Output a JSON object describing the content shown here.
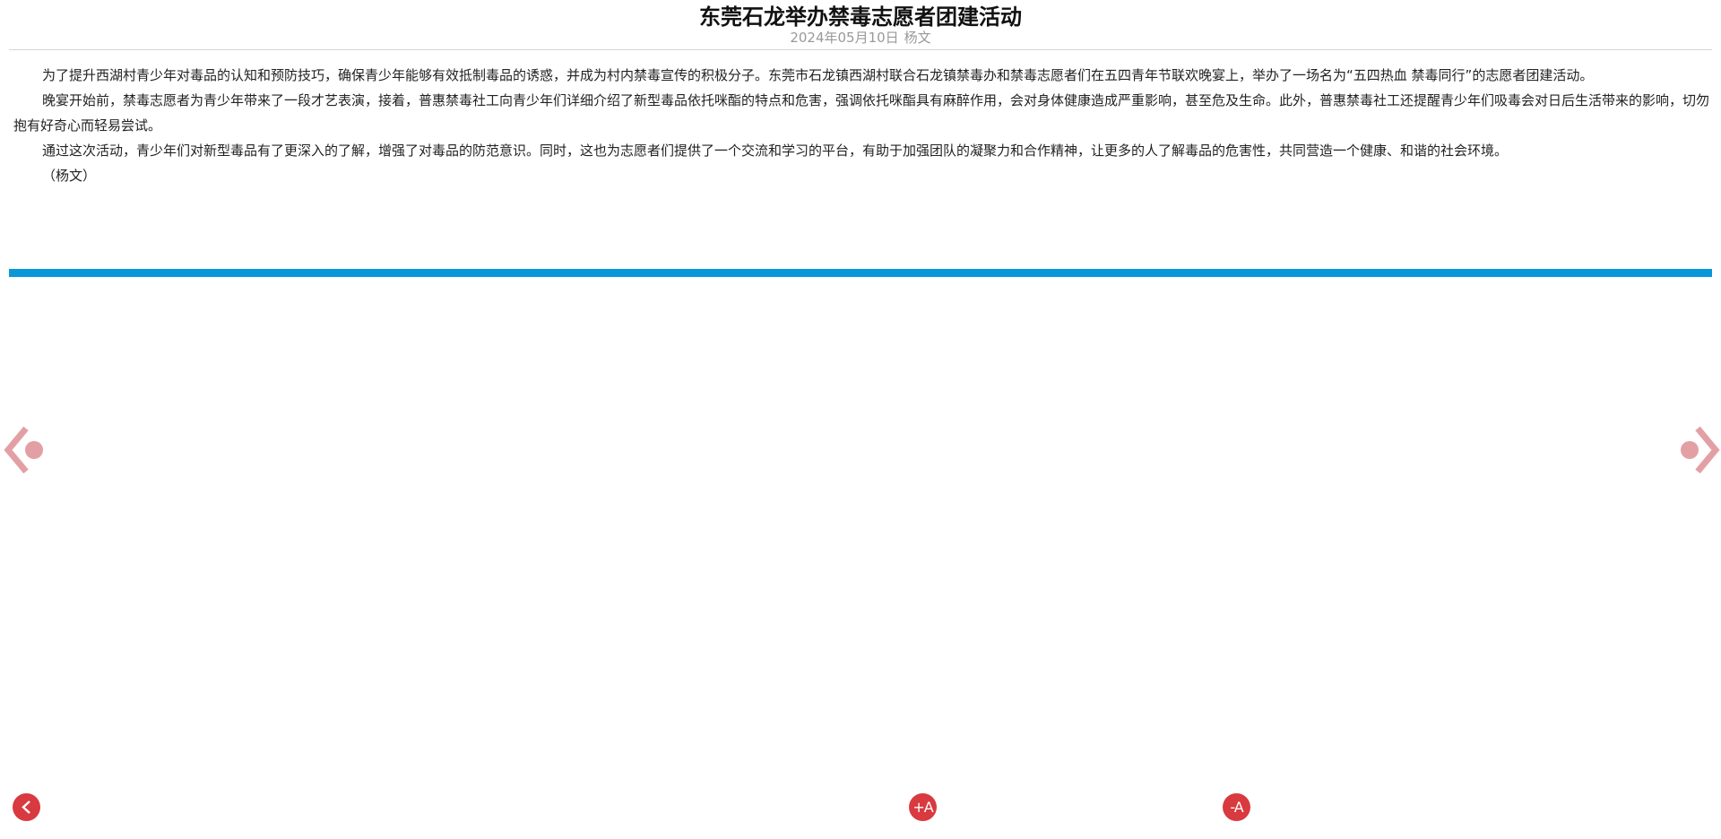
{
  "article": {
    "title": "东莞石龙举办禁毒志愿者团建活动",
    "date": "2024年05月10日",
    "author": "杨文",
    "paragraphs": [
      "为了提升西湖村青少年对毒品的认知和预防技巧，确保青少年能够有效抵制毒品的诱惑，并成为村内禁毒宣传的积极分子。东莞市石龙镇西湖村联合石龙镇禁毒办和禁毒志愿者们在五四青年节联欢晚宴上，举办了一场名为“五四热血 禁毒同行”的志愿者团建活动。",
      "晚宴开始前，禁毒志愿者为青少年带来了一段才艺表演，接着，普惠禁毒社工向青少年们详细介绍了新型毒品依托咪酯的特点和危害，强调依托咪酯具有麻醉作用，会对身体健康造成严重影响，甚至危及生命。此外，普惠禁毒社工还提醒青少年们吸毒会对日后生活带来的影响，切勿抱有好奇心而轻易尝试。",
      "通过这次活动，青少年们对新型毒品有了更深入的了解，增强了对毒品的防范意识。同时，这也为志愿者们提供了一个交流和学习的平台，有助于加强团队的凝聚力和合作精神，让更多的人了解毒品的危害性，共同营造一个健康、和谐的社会环境。",
      "（杨文）"
    ]
  },
  "carousel": {
    "prev_icon": "chevron-left-dot-icon",
    "next_icon": "chevron-right-dot-icon",
    "arrow_color": "#e3a0a4"
  },
  "toolbar": {
    "back_icon": "chevron-left-icon",
    "font_increase_label": "+A",
    "font_decrease_label": "-A",
    "button_color": "#d83a3f"
  },
  "colors": {
    "accent_bar": "#0a97d9",
    "meta_text": "#999999"
  }
}
